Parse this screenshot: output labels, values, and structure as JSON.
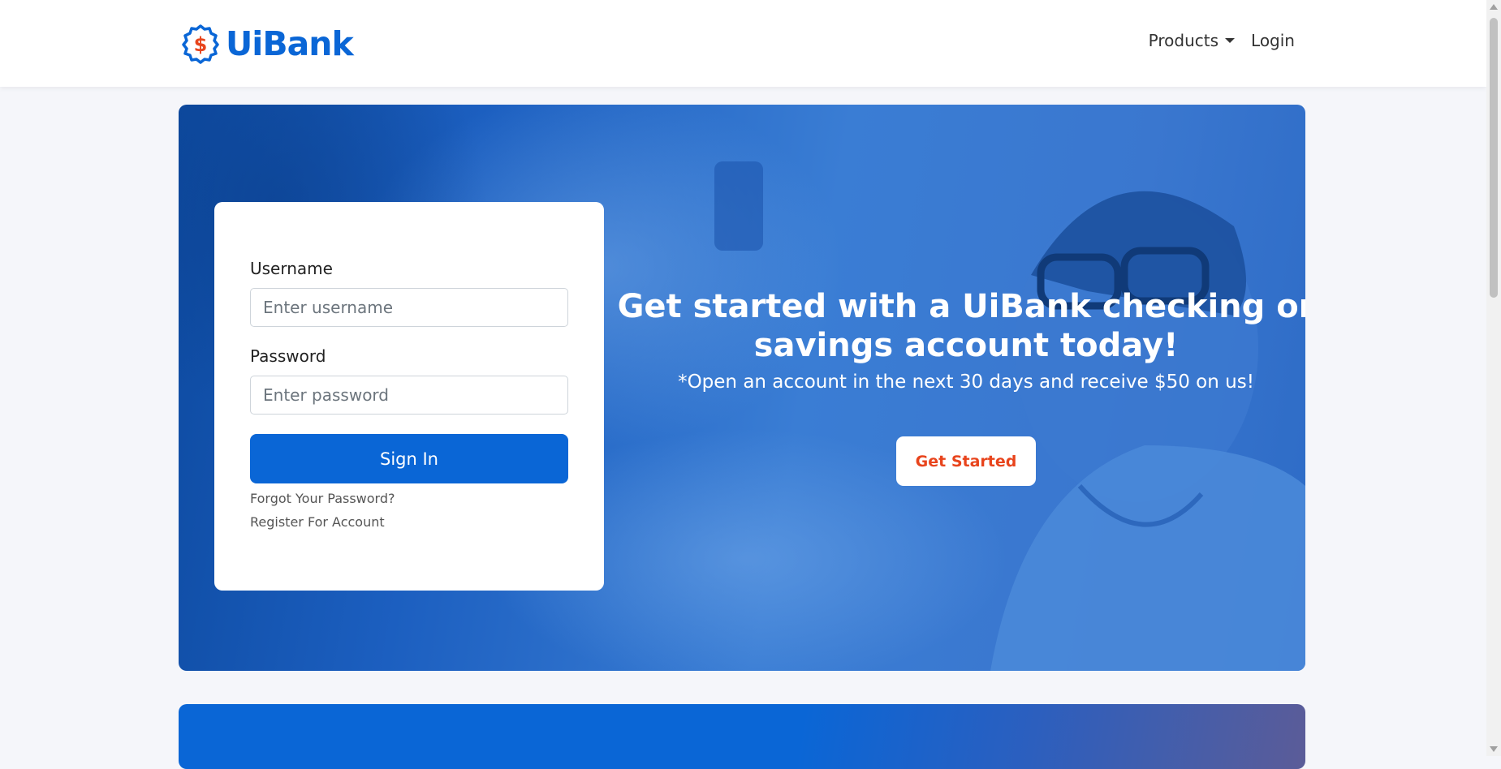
{
  "header": {
    "brand": "UiBank",
    "nav": {
      "products": "Products",
      "login": "Login"
    }
  },
  "login": {
    "username_label": "Username",
    "username_placeholder": "Enter username",
    "password_label": "Password",
    "password_placeholder": "Enter password",
    "signin_label": "Sign In",
    "forgot_label": "Forgot Your Password?",
    "register_label": "Register For Account"
  },
  "hero": {
    "title": "Get started with a UiBank checking or savings account today!",
    "subtitle": "*Open an account in the next 30 days and receive $50 on us!",
    "cta_label": "Get Started"
  },
  "colors": {
    "brand_blue": "#0a66d6",
    "accent_orange": "#e8441c"
  },
  "icons": {
    "logo": "dollar-badge-icon",
    "products_caret": "caret-down-icon"
  }
}
